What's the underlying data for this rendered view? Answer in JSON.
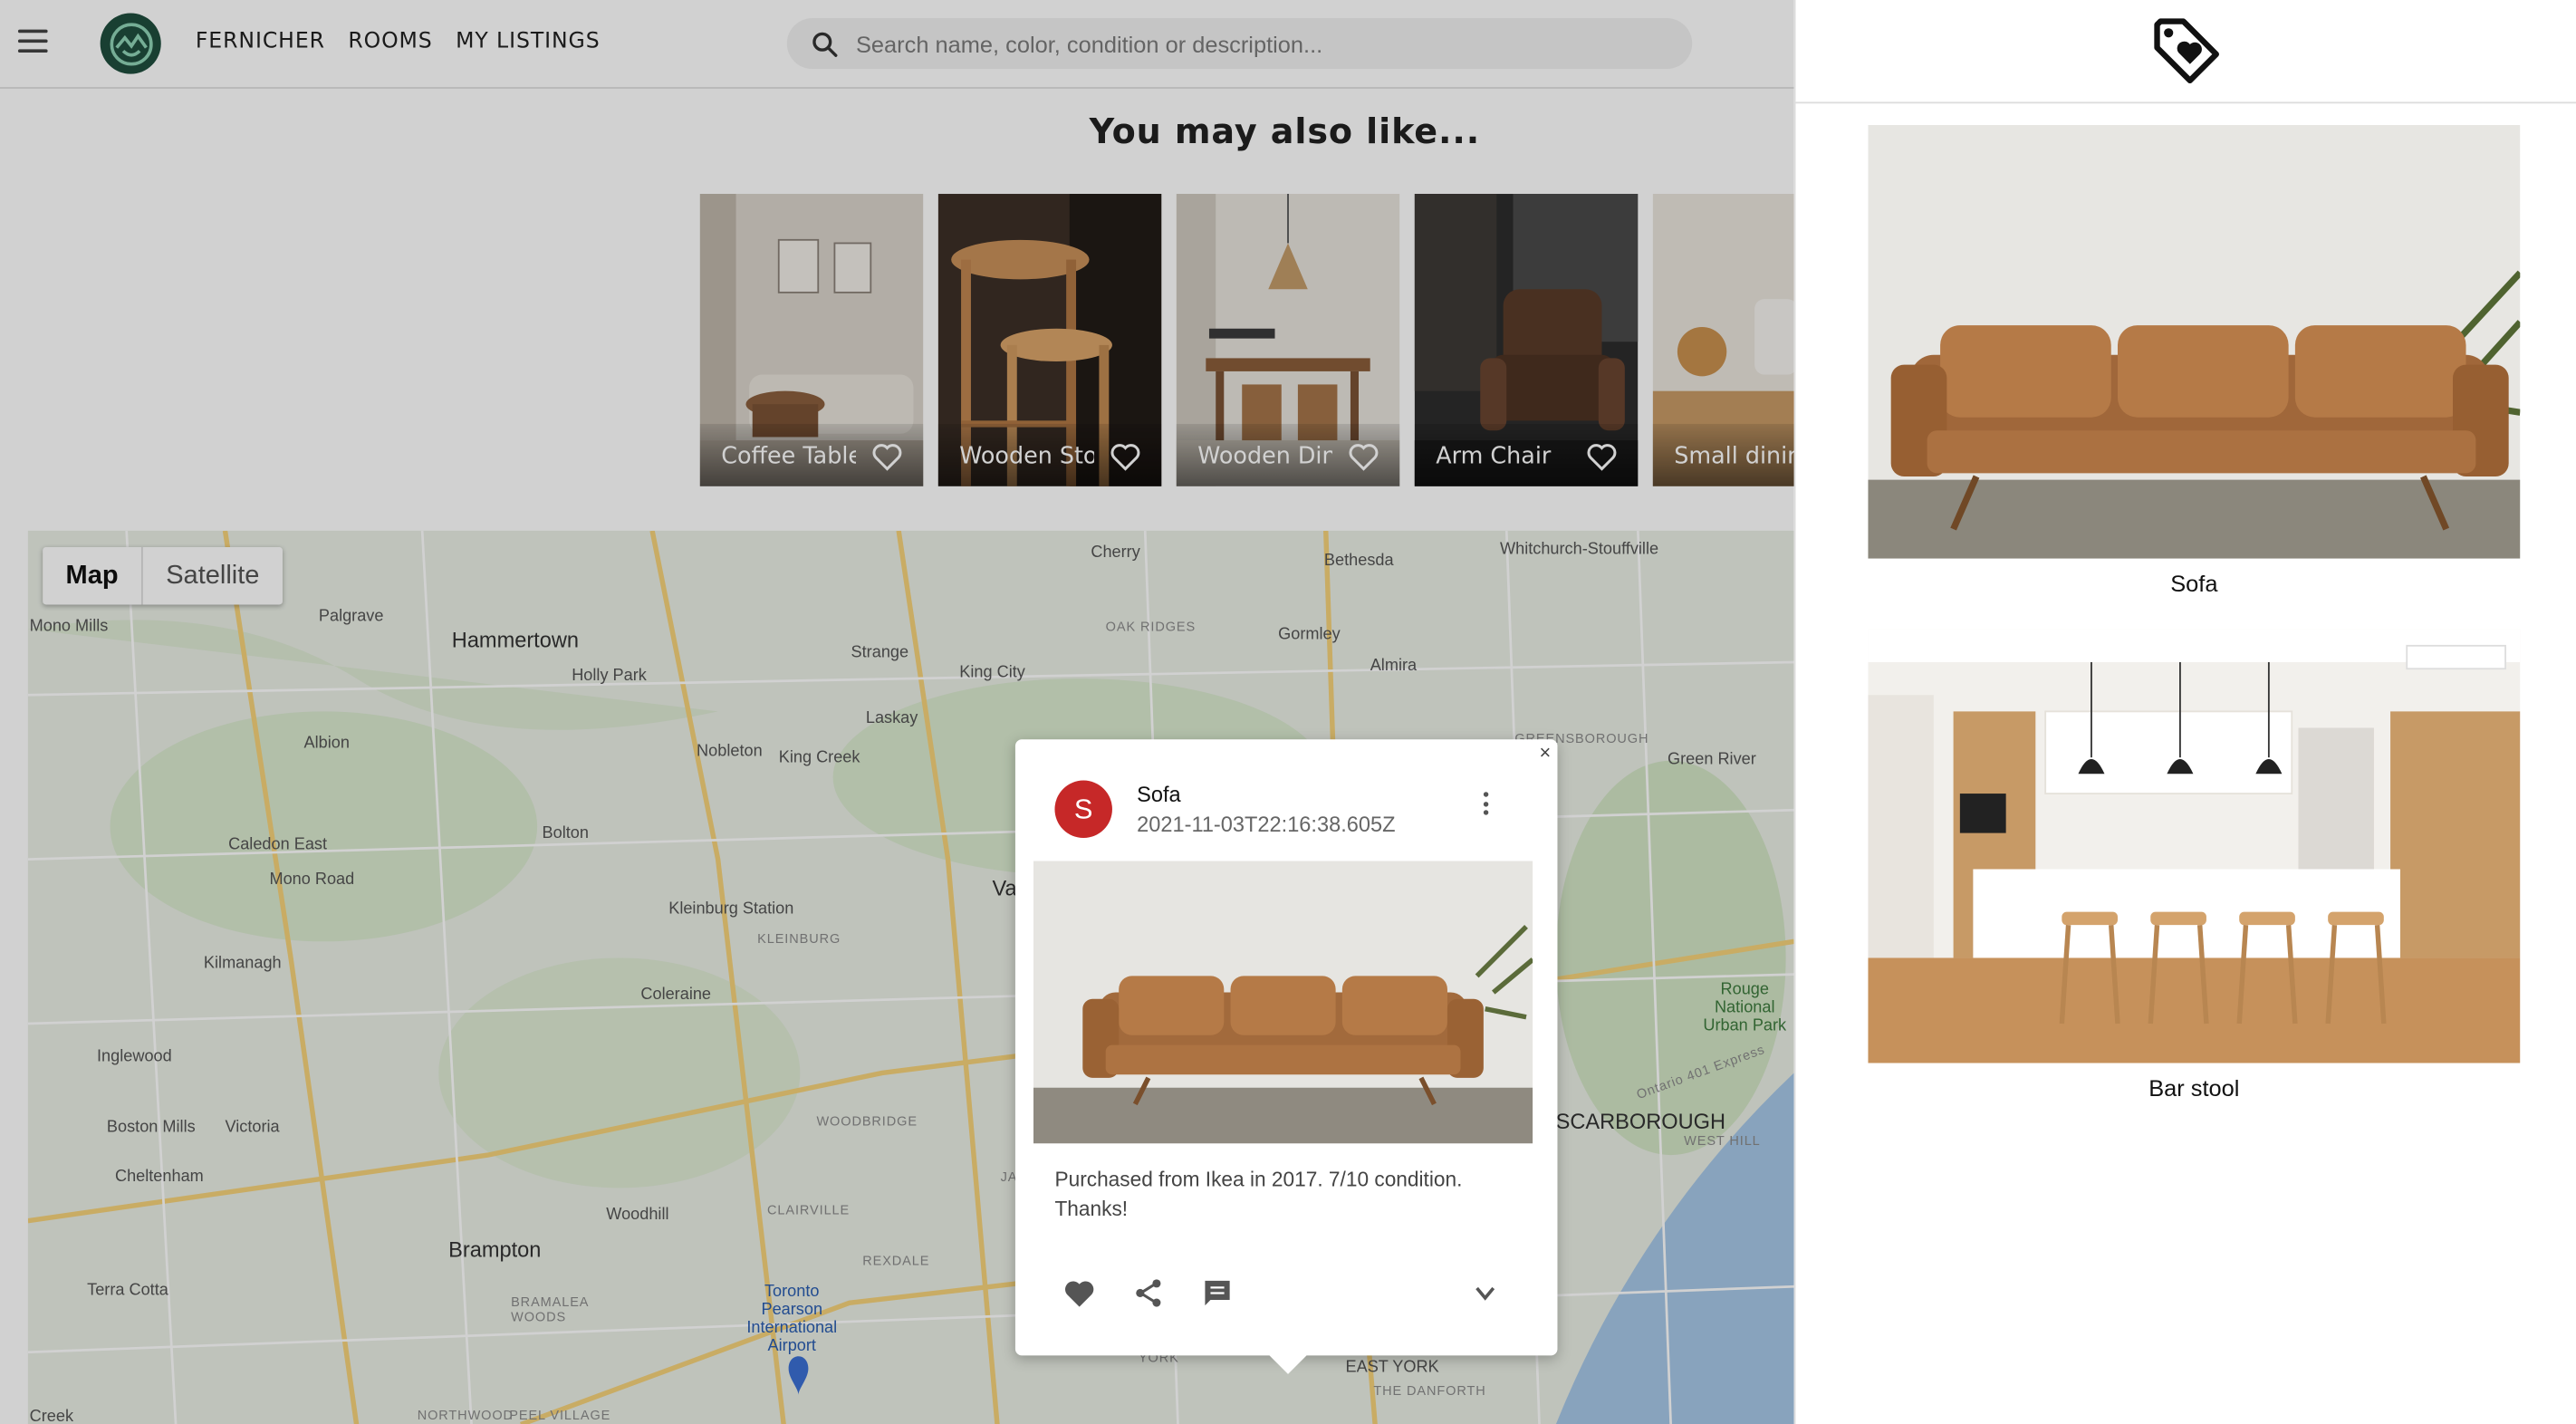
{
  "topbar": {
    "menu_icon": "hamburger-icon",
    "logo_icon": "fernicher-logo",
    "nav": [
      "FERNICHER",
      "ROOMS",
      "MY LISTINGS"
    ],
    "search_placeholder": "Search name, color, condition or description..."
  },
  "recommendations": {
    "title": "You may also like...",
    "items": [
      {
        "label": "Coffee Table"
      },
      {
        "label": "Wooden Stool"
      },
      {
        "label": "Wooden Dining Table"
      },
      {
        "label": "Arm Chair"
      },
      {
        "label": "Small dining"
      }
    ]
  },
  "map": {
    "type_buttons": [
      "Map",
      "Satellite"
    ],
    "labels": [
      "Hammertown",
      "Palgrave",
      "Holly Park",
      "Albion",
      "Caledon East",
      "Mono Road",
      "Bolton",
      "Kilmanagh",
      "Inglewood",
      "Boston Mills",
      "Victoria",
      "Cheltenham",
      "Brampton",
      "Terra Cotta",
      "Woodhill",
      "Kleinburg Station",
      "Coleraine",
      "Nobleton",
      "King Creek",
      "King City",
      "Strange",
      "Laskay",
      "Cherry",
      "Gormley",
      "Almira",
      "Bethesda",
      "Whitchurch-Stouffville",
      "Green River",
      "Toronto Pearson International Airport",
      "Rouge National Urban Park",
      "SCARBOROUGH",
      "EAST YORK",
      "THE DANFORTH",
      "YORK",
      "OAK RIDGES",
      "KLEINBURG",
      "WOODBRIDGE",
      "CLAIRVILLE",
      "REXDALE",
      "BRAMALEA WOODS",
      "NORTHWOOD",
      "PEEL VILLAGE",
      "WEST HILL",
      "Mono Mills",
      "Creek",
      "Va",
      "JANE AND",
      "GREENSBOROUGH",
      "Ontario 401 Express"
    ]
  },
  "popup": {
    "avatar_letter": "S",
    "title": "Sofa",
    "date": "2021-11-03T22:16:38.605Z",
    "description": "Purchased from Ikea in 2017. 7/10 condition. Thanks!",
    "close": "×"
  },
  "drawer": {
    "header_icon": "tag-heart-icon",
    "items": [
      {
        "caption": "Sofa"
      },
      {
        "caption": "Bar stool"
      }
    ]
  }
}
